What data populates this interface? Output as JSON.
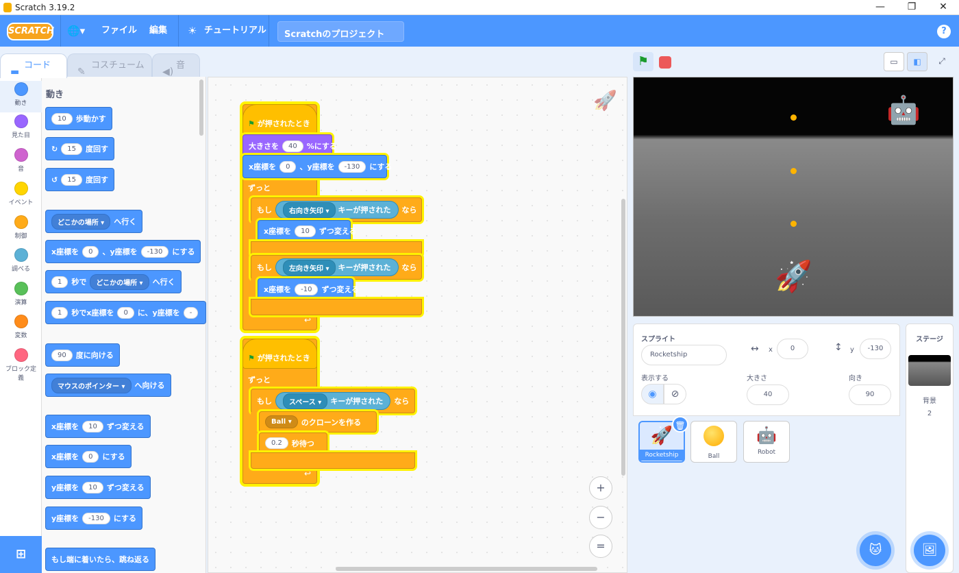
{
  "window": {
    "title": "Scratch 3.19.2",
    "min": "—",
    "max": "❐",
    "close": "✕"
  },
  "menu": {
    "logo": "SCRATCH",
    "globe": "🌐▾",
    "file": "ファイル",
    "edit": "編集",
    "tutorial": "チュートリアル",
    "project_title": "Scratchのプロジェクト",
    "help": "?"
  },
  "tabs": {
    "code": "コード",
    "costume": "コスチューム",
    "sound": "音"
  },
  "categories": [
    {
      "label": "動き",
      "color": "#4c97ff"
    },
    {
      "label": "見た目",
      "color": "#9966ff"
    },
    {
      "label": "音",
      "color": "#cf63cf"
    },
    {
      "label": "イベント",
      "color": "#ffd500"
    },
    {
      "label": "制御",
      "color": "#ffab19"
    },
    {
      "label": "調べる",
      "color": "#5cb1d6"
    },
    {
      "label": "演算",
      "color": "#59c059"
    },
    {
      "label": "変数",
      "color": "#ff8c1a"
    },
    {
      "label": "ブロック定義",
      "color": "#ff6680"
    }
  ],
  "palette": {
    "heading": "動き",
    "move": {
      "n": "10",
      "t": "歩動かす"
    },
    "turn_r": {
      "n": "15",
      "t": "度回す"
    },
    "turn_l": {
      "n": "15",
      "t": "度回す"
    },
    "goto": {
      "dd": "どこかの場所 ▾",
      "t": "へ行く"
    },
    "gotoxy": {
      "a": "x座標を",
      "x": "0",
      "b": "、y座標を",
      "y": "-130",
      "c": "にする"
    },
    "glide": {
      "n": "1",
      "a": "秒で",
      "dd": "どこかの場所 ▾",
      "b": "へ行く"
    },
    "glidexy": {
      "n": "1",
      "a": "秒でx座標を",
      "x": "0",
      "b": "に、y座標を",
      "y": "-"
    },
    "point": {
      "n": "90",
      "t": "度に向ける"
    },
    "pointto": {
      "dd": "マウスのポインター ▾",
      "t": "へ向ける"
    },
    "changex": {
      "a": "x座標を",
      "n": "10",
      "b": "ずつ変える"
    },
    "setx": {
      "a": "x座標を",
      "n": "0",
      "b": "にする"
    },
    "changey": {
      "a": "y座標を",
      "n": "10",
      "b": "ずつ変える"
    },
    "sety": {
      "a": "y座標を",
      "n": "-130",
      "b": "にする"
    },
    "bounce": {
      "t": "もし端に着いたら、跳ね返る"
    }
  },
  "script1": {
    "hat": "が押されたとき",
    "size": {
      "a": "大きさを",
      "n": "40",
      "b": "%にする"
    },
    "gotoxy": {
      "a": "x座標を",
      "x": "0",
      "b": "、y座標を",
      "y": "-130",
      "c": "にする"
    },
    "forever": "ずっと",
    "if1": {
      "a": "もし",
      "dd": "右向き矢印 ▾",
      "b": "キーが押された",
      "c": "なら"
    },
    "change1": {
      "a": "x座標を",
      "n": "10",
      "b": "ずつ変える"
    },
    "if2": {
      "a": "もし",
      "dd": "左向き矢印 ▾",
      "b": "キーが押された",
      "c": "なら"
    },
    "change2": {
      "a": "x座標を",
      "n": "-10",
      "b": "ずつ変える"
    },
    "loop": "↩"
  },
  "script2": {
    "hat": "が押されたとき",
    "forever": "ずっと",
    "if": {
      "a": "もし",
      "dd": "スペース ▾",
      "b": "キーが押された",
      "c": "なら"
    },
    "clone": {
      "dd": "Ball ▾",
      "t": "のクローンを作る"
    },
    "wait": {
      "n": "0.2",
      "t": "秒待つ"
    },
    "loop": "↩"
  },
  "zoom": {
    "in": "+",
    "out": "−",
    "reset": "="
  },
  "stage_controls": {
    "flag": "⚑"
  },
  "sprite_info": {
    "sprite_label": "スプライト",
    "sprite_name": "Rocketship",
    "x_label": "x",
    "x": "0",
    "y_label": "y",
    "y": "-130",
    "show_label": "表示する",
    "size_label": "大きさ",
    "size": "40",
    "dir_label": "向き",
    "dir": "90"
  },
  "sprites": [
    {
      "name": "Rocketship"
    },
    {
      "name": "Ball"
    },
    {
      "name": "Robot"
    }
  ],
  "stage_panel": {
    "title": "ステージ",
    "backdrop_label": "背景",
    "backdrop_count": "2"
  }
}
